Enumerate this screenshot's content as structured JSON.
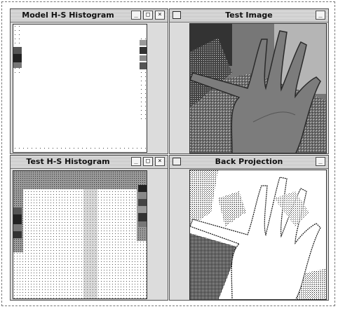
{
  "windows": {
    "model_hist": {
      "title": "Model H-S Histogram",
      "buttons": [
        "_",
        "□",
        "×"
      ]
    },
    "test_image": {
      "title": "Test Image",
      "buttons": [
        "_"
      ]
    },
    "test_hist": {
      "title": "Test H-S Histogram",
      "buttons": [
        "_",
        "□",
        "×"
      ]
    },
    "back_proj": {
      "title": "Back Projection",
      "buttons": [
        "_"
      ]
    }
  },
  "colors": {
    "titlebar_dark": "#bdbdbd",
    "titlebar_light": "#e8e8e8",
    "frame": "#555555"
  }
}
